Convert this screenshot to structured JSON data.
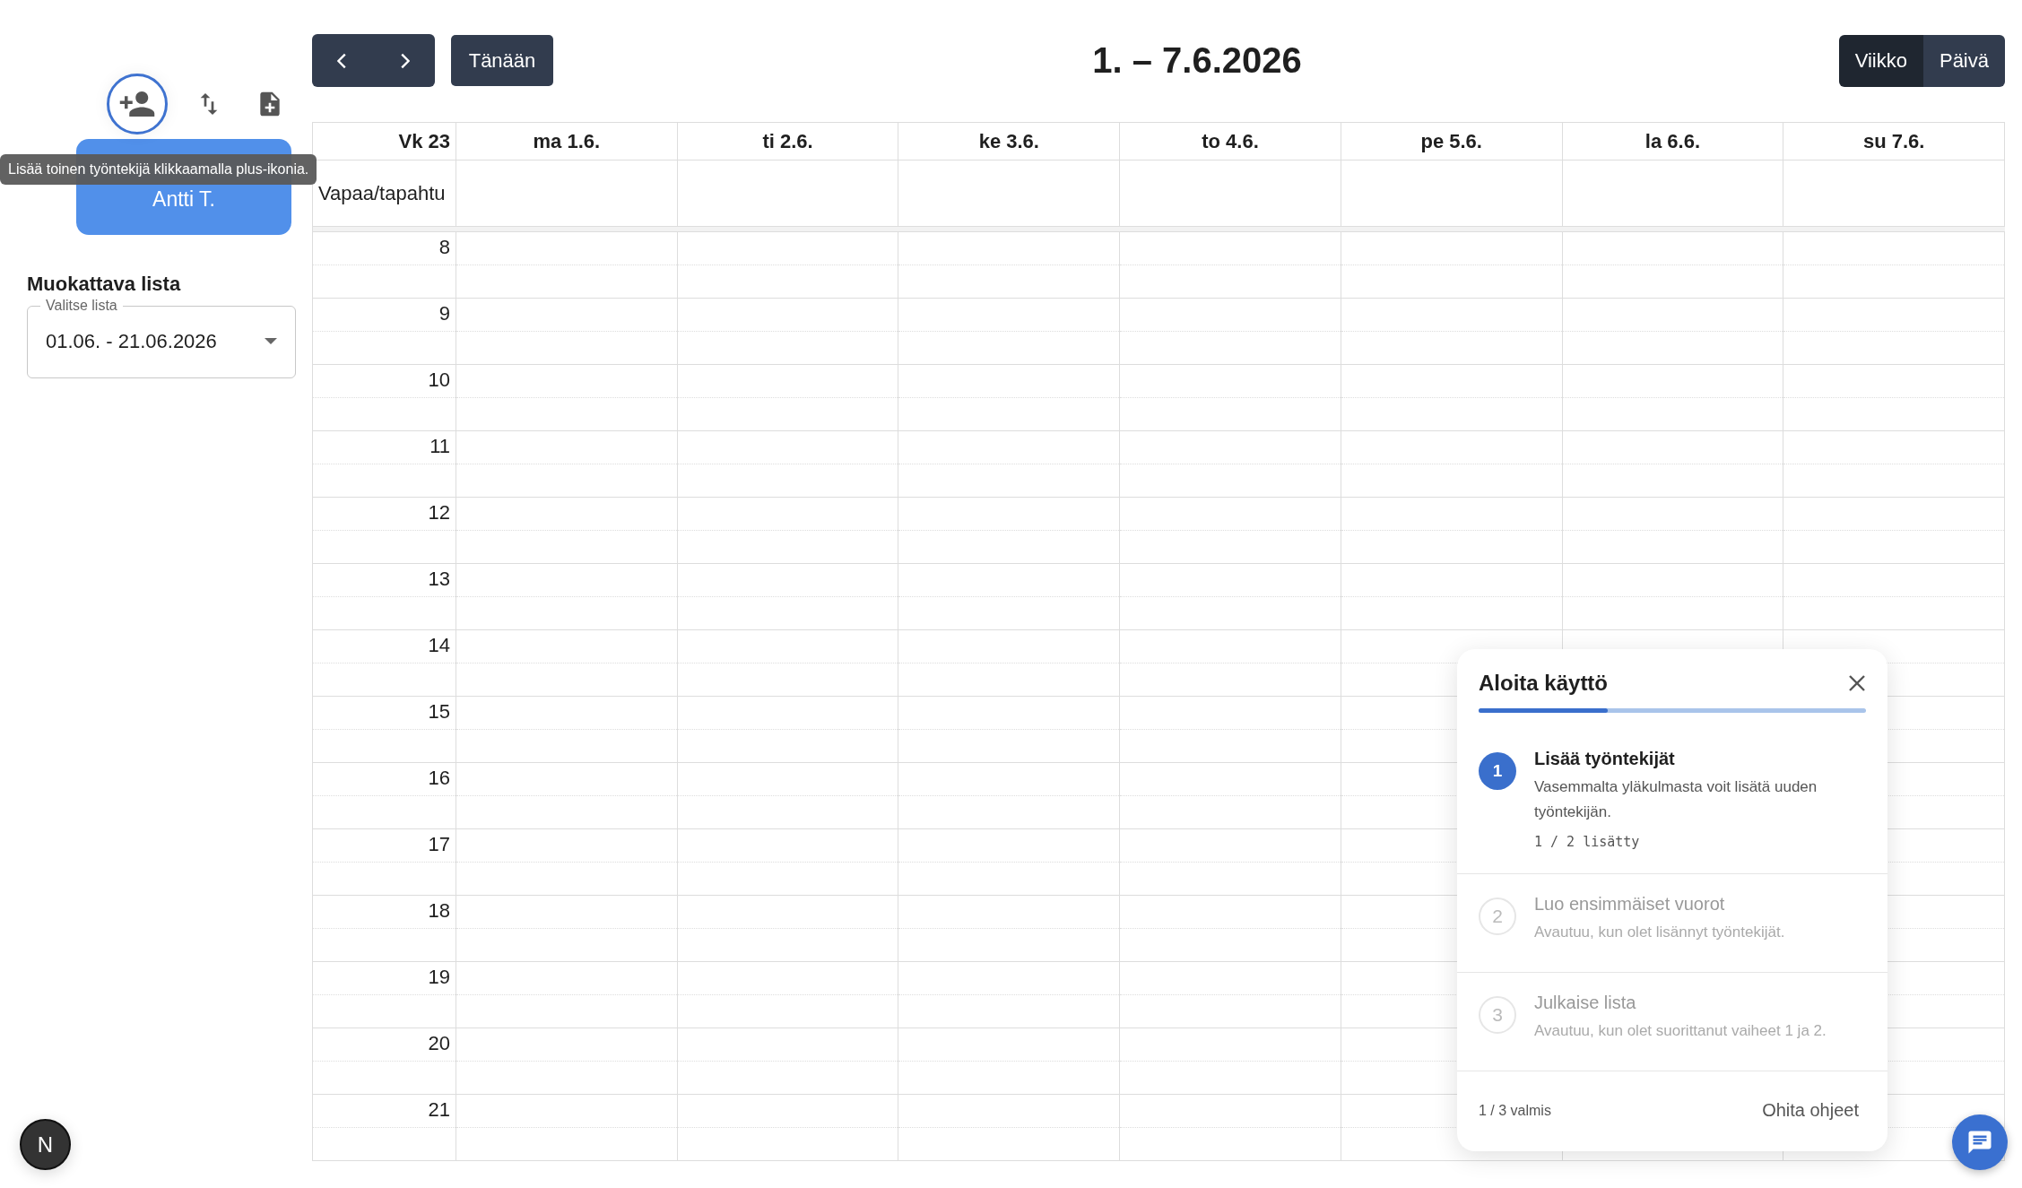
{
  "sidebar": {
    "tools": [
      {
        "kind": "add-person",
        "focused": true
      },
      {
        "kind": "sort",
        "focused": false
      },
      {
        "kind": "new-document",
        "focused": false
      }
    ],
    "employees": [
      {
        "name": "Antti T."
      }
    ],
    "tooltip": "Lisää toinen työntekijä klikkaamalla plus-ikonia.",
    "list_title": "Muokattava lista",
    "list_field": {
      "label": "Valitse lista",
      "value": "01.06. - 21.06.2026"
    }
  },
  "toolbar": {
    "today": "Tänään",
    "title": "1. – 7.6.2026",
    "views": [
      {
        "label": "Viikko",
        "selected": true
      },
      {
        "label": "Päivä",
        "selected": false
      }
    ]
  },
  "calendar": {
    "week": "Vk 23",
    "days": [
      "ma 1.6.",
      "ti 2.6.",
      "ke 3.6.",
      "to 4.6.",
      "pe 5.6.",
      "la 6.6.",
      "su 7.6."
    ],
    "allday_label": "Vapaa/tapahtu",
    "hours": [
      "8",
      "9",
      "10",
      "11",
      "12",
      "13",
      "14",
      "15",
      "16",
      "17",
      "18",
      "19",
      "20",
      "21"
    ]
  },
  "onboarding": {
    "title": "Aloita käyttö",
    "level": 0.333,
    "steps": [
      {
        "number": "1",
        "title": "Lisää työntekijät",
        "description": "Vasemmalta yläkulmasta voit lisätä uuden työntekijän.",
        "progress": "1 / 2 lisätty",
        "active": true
      },
      {
        "number": "2",
        "title": "Luo ensimmäiset vuorot",
        "description": "Avautuu, kun olet lisännyt työntekijät.",
        "active": false
      },
      {
        "number": "3",
        "title": "Julkaise lista",
        "description": "Avautuu, kun olet suorittanut vaiheet 1 ja 2.",
        "active": false
      }
    ],
    "status": "1 / 3 valmis",
    "skip": "Ohita ohjeet"
  },
  "dev_badge": {
    "letter": "N"
  }
}
